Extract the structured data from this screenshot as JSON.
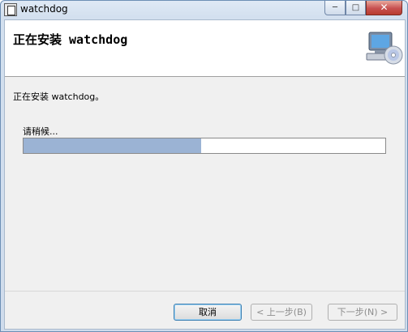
{
  "window": {
    "title": "watchdog",
    "minimize_glyph": "─",
    "maximize_glyph": "□",
    "close_glyph": "✕"
  },
  "banner": {
    "title": "正在安装 watchdog",
    "icon": "computer-cd-icon"
  },
  "body": {
    "status": "正在安装 watchdog。",
    "wait": "请稍候...",
    "progress": 0.49
  },
  "buttons": {
    "cancel": "取消",
    "back": "< 上一步(B)",
    "next": "下一步(N) >"
  },
  "colors": {
    "progress_fill": "#9bb3d4",
    "close_button": "#c75050"
  }
}
